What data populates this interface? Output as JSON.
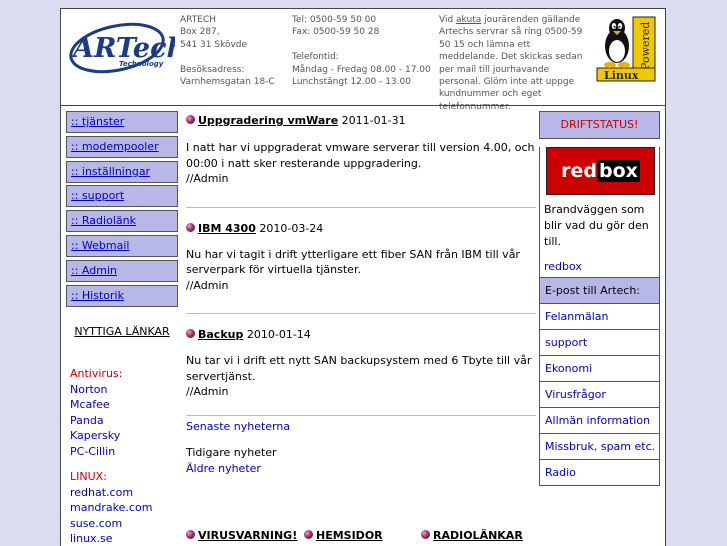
{
  "header": {
    "company": "ARTECH",
    "address": [
      "Box 287,",
      "541 31 Skövde"
    ],
    "visit_label": "Besöksadress:",
    "visit_address": "Varnhemsgatan 18-C",
    "phone": "Tel: 0500-59 50 00",
    "fax": "Fax: 0500-59 50 28",
    "hours_label": "Telefontid:",
    "hours_weekday": "Måndag - Fredag 08.00 - 17.00",
    "hours_lunch": "Lunchstängt 12.00 - 13.00",
    "notice_pre": "Vid ",
    "notice_link": "akuta",
    "notice_post": " jourärenden gällande Artechs servrar så ring 0500-59 50 15 och lämna ett meddelande. Det skickas sedan per mail till jourhavande personal. Glöm inte att uppge kundnummer och eget telefonnummer.",
    "logo_text": "ARTech",
    "logo_sub": "Technology",
    "powered_top": "Powered",
    "powered_bottom": "Linux"
  },
  "leftnav": {
    "items": [
      ":: tjänster",
      ":: modempooler",
      ":: inställningar",
      ":: support",
      ":: Radiolänk",
      ":: Webmail",
      ":: Admin",
      ":: Historik"
    ],
    "useful_links": "NYTTIGA LÄNKAR",
    "antivirus_label": "Antivirus:",
    "antivirus": [
      "Norton",
      "Mcafee",
      "Panda",
      "Kapersky",
      "PC-Cillin"
    ],
    "linux_label": "LINUX:",
    "linux": [
      "redhat.com",
      "mandrake.com",
      "suse.com",
      "linux.se"
    ]
  },
  "news": [
    {
      "title": "Uppgradering vmWare",
      "date": "2011-01-31",
      "body": "I natt har vi uppgraderat vmware serverar till version 4.00, och 00:00 i natt sker resterande uppgradering.",
      "sign": "//Admin"
    },
    {
      "title": "IBM 4300",
      "date": "2010-03-24",
      "body": "Nu har vi tagit i drift ytterligare ett fiber SAN från IBM till vår serverpark för virtuella tjänster.",
      "sign": "//Admin"
    },
    {
      "title": "Backup",
      "date": "2010-01-14",
      "body": "Nu tar vi i drift ett nytt SAN backupsystem med 6 Tbyte till vår servertjänst.",
      "sign": "//Admin"
    }
  ],
  "center_links": {
    "latest": "Senaste nyheterna",
    "earlier_label": "Tidigare nyheter",
    "older": "Äldre nyheter"
  },
  "bottom_links": [
    "VIRUSVARNING!",
    "HEMSIDOR",
    "RADIOLÄNKAR"
  ],
  "right": {
    "status_head": "DRIFTSTATUS!",
    "redbox_red": "red",
    "redbox_box": "box",
    "firewall_text": "Brandväggen som blir vad du gör den till.",
    "redbox_link": "redbox",
    "email_head": "E-post till Artech:",
    "email_items": [
      "Felanmälan",
      "support",
      "Ekonomi",
      "Virusfrågor",
      "Allmän information",
      "Missbruk, spam etc.",
      "Radio"
    ]
  }
}
